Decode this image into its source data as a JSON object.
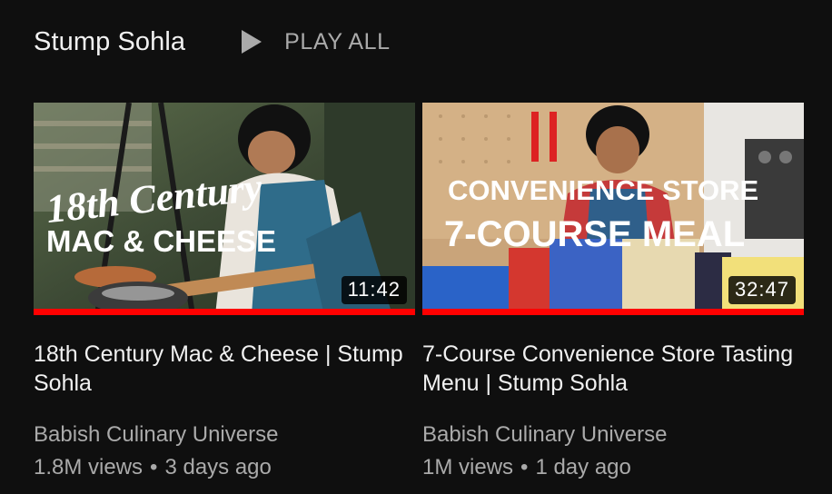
{
  "shelf": {
    "title": "Stump Sohla",
    "play_all_label": "PLAY ALL"
  },
  "videos": [
    {
      "thumbnail_text_line1": "18th Century",
      "thumbnail_text_line2": "MAC & CHEESE",
      "duration": "11:42",
      "watch_progress": 1.0,
      "title": "18th Century Mac & Cheese | Stump Sohla",
      "channel": "Babish Culinary Universe",
      "views": "1.8M views",
      "age": "3 days ago"
    },
    {
      "thumbnail_text_line1": "CONVENIENCE STORE",
      "thumbnail_text_line2": "7-COURSE MEAL",
      "duration": "32:47",
      "watch_progress": 1.0,
      "title": "7-Course Convenience Store Tasting Menu | Stump Sohla",
      "channel": "Babish Culinary Universe",
      "views": "1M views",
      "age": "1 day ago"
    }
  ],
  "meta_separator": "•",
  "colors": {
    "background": "#0f0f0f",
    "progress": "#ff0000",
    "secondary_text": "#aaaaaa",
    "primary_text": "#f1f1f1"
  }
}
